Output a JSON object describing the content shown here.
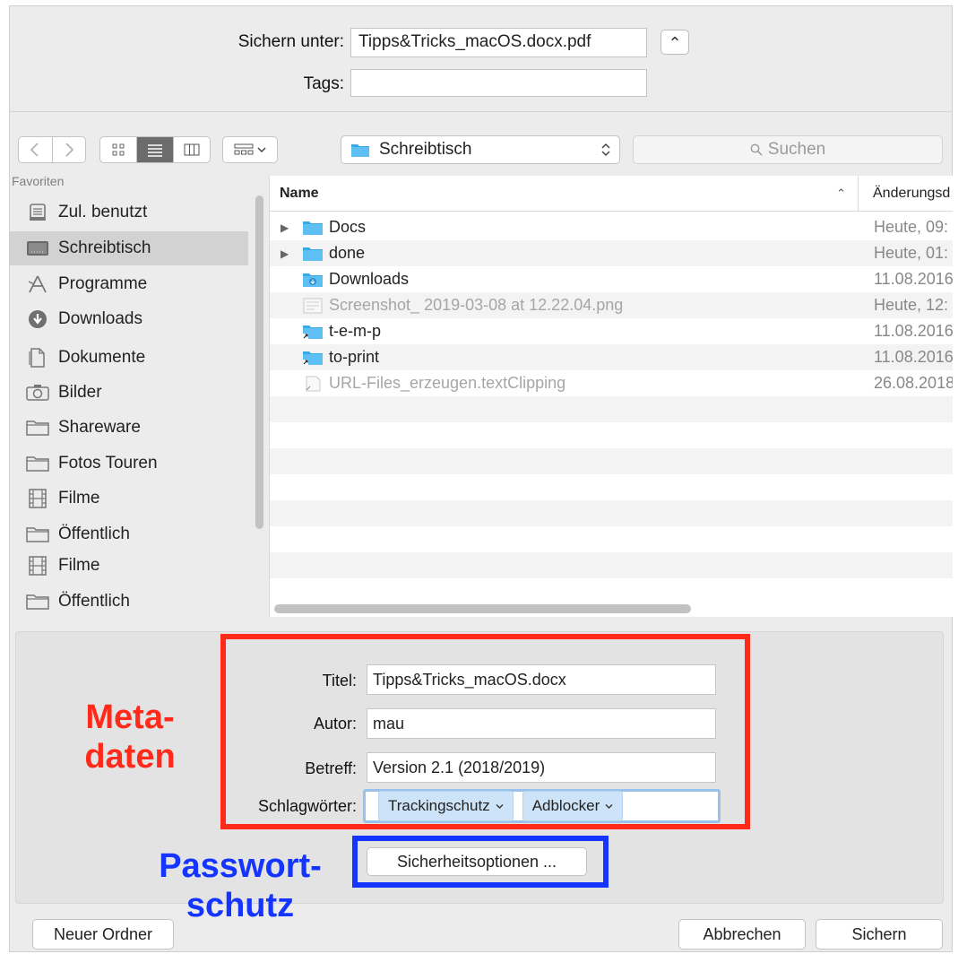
{
  "save": {
    "save_as_label": "Sichern unter:",
    "filename": "Tipps&Tricks_macOS.docx.pdf",
    "tags_label": "Tags:",
    "tags_value": ""
  },
  "toolbar": {
    "location": "Schreibtisch",
    "search_placeholder": "Suchen"
  },
  "sidebar": {
    "header": "Favoriten",
    "items": [
      {
        "label": "Zul. benutzt",
        "icon": "recents-icon"
      },
      {
        "label": "Schreibtisch",
        "icon": "desktop-icon"
      },
      {
        "label": "Programme",
        "icon": "applications-icon"
      },
      {
        "label": "Downloads",
        "icon": "downloads-icon"
      },
      {
        "label": "Dokumente",
        "icon": "documents-icon"
      },
      {
        "label": "Bilder",
        "icon": "camera-icon"
      },
      {
        "label": "Shareware",
        "icon": "folder-icon"
      },
      {
        "label": "Fotos Touren",
        "icon": "folder-icon"
      },
      {
        "label": "Filme",
        "icon": "film-icon"
      },
      {
        "label": "Öffentlich",
        "icon": "folder-icon"
      },
      {
        "label": "Filme",
        "icon": "film-icon"
      },
      {
        "label": "Öffentlich",
        "icon": "folder-icon"
      }
    ]
  },
  "files": {
    "col_name": "Name",
    "col_date": "Änderungsd",
    "rows": [
      {
        "name": "Docs",
        "date": "Heute, 09:",
        "type": "folder"
      },
      {
        "name": "done",
        "date": "Heute, 01:",
        "type": "folder"
      },
      {
        "name": "Downloads",
        "date": "11.08.2016",
        "type": "folder-downloads"
      },
      {
        "name": "Screenshot_ 2019-03-08 at 12.22.04.png",
        "date": "Heute, 12:",
        "type": "image"
      },
      {
        "name": "t-e-m-p",
        "date": "11.08.2016",
        "type": "alias-folder"
      },
      {
        "name": "to-print",
        "date": "11.08.2016",
        "type": "alias-folder"
      },
      {
        "name": "URL-Files_erzeugen.textClipping",
        "date": "26.08.2018",
        "type": "clipping"
      }
    ]
  },
  "meta": {
    "title_label": "Titel:",
    "title_value": "Tipps&Tricks_macOS.docx",
    "author_label": "Autor:",
    "author_value": "mau",
    "subject_label": "Betreff:",
    "subject_value": "Version 2.1 (2018/2019)",
    "keywords_label": "Schlagwörter:",
    "keywords": [
      "Trackingschutz",
      "Adblocker"
    ],
    "security_button": "Sicherheitsoptionen ..."
  },
  "annotations": {
    "meta_line1": "Meta-",
    "meta_line2": "daten",
    "meta_color": "#ff2a1a",
    "pw_line1": "Passwort-",
    "pw_line2": "schutz",
    "pw_color": "#1434ff"
  },
  "buttons": {
    "new_folder": "Neuer Ordner",
    "cancel": "Abbrechen",
    "save": "Sichern"
  }
}
